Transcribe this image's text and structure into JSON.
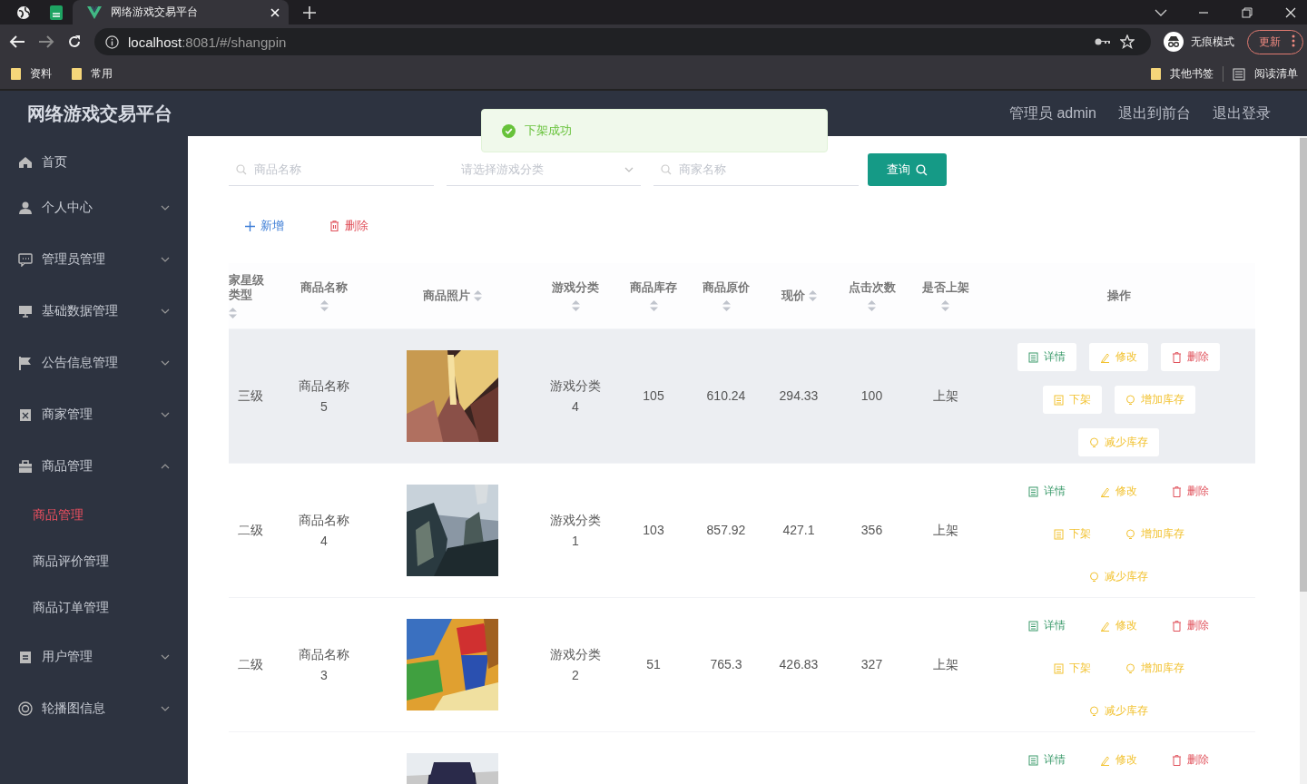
{
  "browser": {
    "tabs": [
      {
        "kind": "globe",
        "selected": false
      },
      {
        "kind": "sheet",
        "selected": false
      },
      {
        "kind": "page",
        "title": "网络游戏交易平台",
        "selected": true
      }
    ],
    "url_host": "localhost",
    "url_path": ":8081/#/shangpin",
    "profile": "无痕模式",
    "update": "更新",
    "bookmarks": [
      "资料",
      "常用"
    ],
    "bookmarks_right": [
      {
        "kind": "folder",
        "label": "其他书签"
      },
      {
        "kind": "list",
        "label": "阅读清单"
      }
    ]
  },
  "header": {
    "title": "网络游戏交易平台",
    "links": [
      "管理员 admin",
      "退出到前台",
      "退出登录"
    ]
  },
  "toast": {
    "kind": "success",
    "text": "下架成功"
  },
  "sidebar": {
    "items": [
      {
        "label": "首页"
      },
      {
        "label": "个人中心",
        "expanded": false
      },
      {
        "label": "管理员管理",
        "expanded": false
      },
      {
        "label": "基础数据管理",
        "expanded": false
      },
      {
        "label": "公告信息管理",
        "expanded": false
      },
      {
        "label": "商家管理",
        "expanded": false
      },
      {
        "label": "商品管理",
        "expanded": true,
        "children": [
          {
            "label": "商品管理",
            "selected": true
          },
          {
            "label": "商品评价管理",
            "selected": false
          },
          {
            "label": "商品订单管理",
            "selected": false
          }
        ]
      },
      {
        "label": "用户管理",
        "expanded": false
      },
      {
        "label": "轮播图信息",
        "expanded": false
      }
    ]
  },
  "search": {
    "fields": [
      {
        "kind": "input",
        "placeholder": "商品名称"
      },
      {
        "kind": "select",
        "placeholder": "请选择游戏分类"
      },
      {
        "kind": "input",
        "placeholder": "商家名称"
      }
    ],
    "button": "查询"
  },
  "actions": [
    {
      "kind": "add",
      "label": "新增"
    },
    {
      "kind": "delete",
      "label": "删除"
    }
  ],
  "table": {
    "columns": [
      {
        "kind": "clipped",
        "label": "家星级类型",
        "sortable": true
      },
      {
        "kind": "text",
        "label": "商品名称",
        "sortable": true
      },
      {
        "label": "商品照片",
        "sortable": true
      },
      {
        "kind": "text",
        "label": "游戏分类",
        "sortable": true
      },
      {
        "kind": "text",
        "label": "商品库存",
        "sortable": true
      },
      {
        "kind": "text",
        "label": "商品原价",
        "sortable": true
      },
      {
        "kind": "text",
        "label": "现价",
        "sortable": true
      },
      {
        "kind": "text",
        "label": "点击次数",
        "sortable": true
      },
      {
        "kind": "text",
        "label": "是否上架",
        "sortable": true
      },
      {
        "kind": "ops",
        "label": "操作",
        "sortable": false
      }
    ],
    "rows": [
      {
        "hovered": true,
        "cells": [
          "三级",
          "商品名称5",
          {
            "kind": "picture"
          },
          "游戏分类4",
          "105",
          "610.24",
          "294.33",
          "100",
          "上架"
        ],
        "ops": [
          {
            "kind": "detail",
            "label": "详情"
          },
          {
            "kind": "edit",
            "label": "修改"
          },
          {
            "kind": "delete",
            "label": "删除"
          },
          {
            "kind": "offshelf",
            "label": "下架"
          },
          {
            "kind": "stock",
            "label": "增加库存"
          },
          {
            "kind": "stock",
            "label": "减少库存"
          }
        ]
      },
      {
        "hovered": false,
        "cells": [
          "二级",
          "商品名称4",
          {
            "kind": "picture"
          },
          "游戏分类1",
          "103",
          "857.92",
          "427.1",
          "356",
          "上架"
        ],
        "ops": [
          {
            "kind": "detail",
            "label": "详情"
          },
          {
            "kind": "edit",
            "label": "修改"
          },
          {
            "kind": "delete",
            "label": "删除"
          },
          {
            "kind": "offshelf",
            "label": "下架"
          },
          {
            "kind": "stock",
            "label": "增加库存"
          },
          {
            "kind": "stock",
            "label": "减少库存"
          }
        ]
      },
      {
        "hovered": false,
        "cells": [
          "二级",
          "商品名称3",
          {
            "kind": "picture"
          },
          "游戏分类2",
          "51",
          "765.3",
          "426.83",
          "327",
          "上架"
        ],
        "ops": [
          {
            "kind": "detail",
            "label": "详情"
          },
          {
            "kind": "edit",
            "label": "修改"
          },
          {
            "kind": "delete",
            "label": "删除"
          },
          {
            "kind": "offshelf",
            "label": "下架"
          },
          {
            "kind": "stock",
            "label": "增加库存"
          },
          {
            "kind": "stock",
            "label": "减少库存"
          }
        ]
      },
      {
        "hovered": false,
        "cells": [
          null,
          null,
          {
            "kind": "picture"
          },
          null,
          null,
          null,
          null,
          null,
          null
        ],
        "ops": [
          {
            "kind": "detail",
            "label": "详情"
          },
          {
            "kind": "edit",
            "label": "修改"
          },
          {
            "kind": "delete",
            "label": "删除"
          }
        ]
      }
    ]
  }
}
